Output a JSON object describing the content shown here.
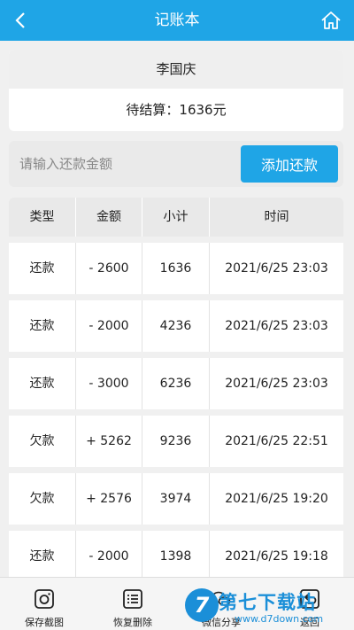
{
  "header": {
    "title": "记账本",
    "back_icon": "chevron-left-icon",
    "home_icon": "home-icon"
  },
  "card": {
    "name": "李国庆",
    "pending": "待结算：1636元"
  },
  "repay": {
    "placeholder": "请输入还款金额",
    "button": "添加还款"
  },
  "table": {
    "columns": [
      "类型",
      "金额",
      "小计",
      "时间"
    ],
    "rows": [
      [
        "还款",
        "- 2600",
        "1636",
        "2021/6/25 23:03"
      ],
      [
        "还款",
        "- 2000",
        "4236",
        "2021/6/25 23:03"
      ],
      [
        "还款",
        "- 3000",
        "6236",
        "2021/6/25 23:03"
      ],
      [
        "欠款",
        "+ 5262",
        "9236",
        "2021/6/25 22:51"
      ],
      [
        "欠款",
        "+ 2576",
        "3974",
        "2021/6/25 19:20"
      ],
      [
        "还款",
        "- 2000",
        "1398",
        "2021/6/25 19:18"
      ]
    ]
  },
  "bottom": {
    "tabs": [
      {
        "label": "保存截图",
        "icon": "camera-icon"
      },
      {
        "label": "恢复删除",
        "icon": "list-icon"
      },
      {
        "label": "微信分享",
        "icon": "wechat-icon"
      },
      {
        "label": "返回",
        "icon": "back-icon"
      }
    ]
  },
  "watermark": {
    "text": "第七下载站",
    "url": "www.d7down.com",
    "logo": "7"
  },
  "colors": {
    "accent": "#1fa5e6"
  }
}
